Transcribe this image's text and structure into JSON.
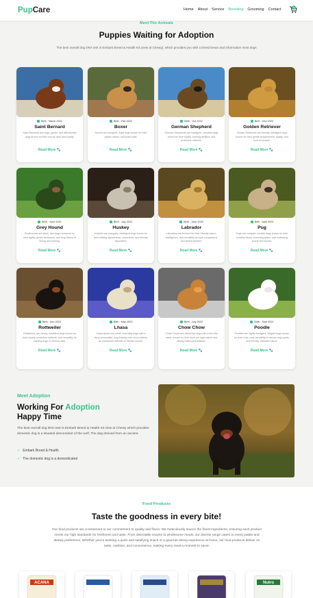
{
  "nav": {
    "logo_a": "Pup",
    "logo_b": "Care",
    "items": [
      {
        "label": "Home",
        "active": false
      },
      {
        "label": "About",
        "active": false
      },
      {
        "label": "Service",
        "active": false
      },
      {
        "label": "Breeding",
        "active": true
      },
      {
        "label": "Grooming",
        "active": false
      },
      {
        "label": "Contact",
        "active": false
      }
    ],
    "cart_icon": "shopping-cart-icon",
    "cart_count": "0"
  },
  "animals": {
    "eyebrow": "Meet The Animals",
    "title": "Puppies Waiting for Adoption",
    "subtitle": "The best overall dog DNA test is Embark Breed & Health Kit (view at Chewy), which provides you with a breed brean and information most dogs",
    "cards": [
      {
        "date": "Birth : March 2021",
        "name": "Saint Bernard",
        "desc": "Saint Bernards are huge, gentle, and affectionate dogs known for their rescue work and loyalty.",
        "more": "Read More"
      },
      {
        "date": "Birth : Feb 2022",
        "name": "Boxer",
        "desc": "Boxers are energetic, loyal dogs known for their playful nature, muscular build.",
        "more": "Read More"
      },
      {
        "date": "Birth : Oct 2022",
        "name": "German Shepherd",
        "desc": "German Shepherds are intelligent, versatile dogs prized for their loyalty, working abilities, and protective instincts.",
        "more": "Read More"
      },
      {
        "date": "Birth : Nov 2022",
        "name": "Golden Retriever",
        "desc": "Golden Retrievers are friendly, intelligent dogs known for their gentle temperament, loyalty, and love for people.",
        "more": "Read More"
      },
      {
        "date": "Birth : June 2021",
        "name": "Grey Hound",
        "desc": "Greyhounds are sleek, fast dogs renowned for their agility, gentle demeanor, and long history in racing and hunting.",
        "more": "Read More"
      },
      {
        "date": "Birth : July 2022",
        "name": "Huskey",
        "desc": "Huskies are energetic, intelligent dogs known for their striking appearance, endurance, and friendly disposition.",
        "more": "Read More"
      },
      {
        "date": "Birth : June 2020",
        "name": "Labrador",
        "desc": "Labradors are beloved for their friendly nature, intelligence, and versatility as loyal companions and skilled workers.",
        "more": "Read More"
      },
      {
        "date": "Birth : April 2023",
        "name": "Pug",
        "desc": "Pugs are compact, lovable dogs known for their wrinkled faces, charming antics, and endearing snorts and snores.",
        "more": "Read More"
      },
      {
        "date": "Birth : Dec 2022",
        "name": "Rottweiler",
        "desc": "Rottweilers are strong, confident dogs known for their loyalty, protective instincts, and versatility as working dogs in various roles.",
        "more": "Read More"
      },
      {
        "date": "Birth : May 2023",
        "name": "Lhasa",
        "desc": "Lhasa Apsos are small, charming dogs with a lively personality, long flowing coat, and a history as companion animals in Tibetan monks.",
        "more": "Read More"
      },
      {
        "date": "Birth : July 2022",
        "name": "Chow Chow",
        "desc": "Chow Chows are distinctive dogs with a lion-like mane, known for their aloof yet loyal nature and strong-willed personalities.",
        "more": "Read More"
      },
      {
        "date": "Birth : Sept 2021",
        "name": "Poodle",
        "desc": "Poodles are highly intelligent, elegant dogs known for their curly coat, versatility in various dog sports, and friendly, trainable nature.",
        "more": "Read More"
      }
    ]
  },
  "adoption": {
    "eyebrow": "Meet Adoption",
    "title_a": "Working For ",
    "title_b": "Adoption",
    "title_c": "Happy Time",
    "desc": "The best overall dog DNA test is Embark Breed & Health Kit view at Chewy which provides domestic dog is a situated descendant of the wolf. The dog derived from an ancient.",
    "checks": [
      "Embark Breed & Health",
      "The domestic dog is a domesticated"
    ]
  },
  "food": {
    "eyebrow": "Food Products",
    "title": "Taste the goodness in every bite!",
    "desc": "Our food products are a testament to our commitment to quality and flavor. We meticulously source the finest ingredients, ensuring each product meets our high standards for freshness and taste. From delectable snacks to wholesome meals, our diverse range caters to every palate and dietary preference. Whether you're seeking a quick and satisfying snack or a gourmet dining experience at home, our food products deliver on taste, nutrition, and convenience, making every meal a moment to savor.",
    "products": [
      "ACANA",
      "",
      "",
      "",
      "Nutro"
    ]
  }
}
